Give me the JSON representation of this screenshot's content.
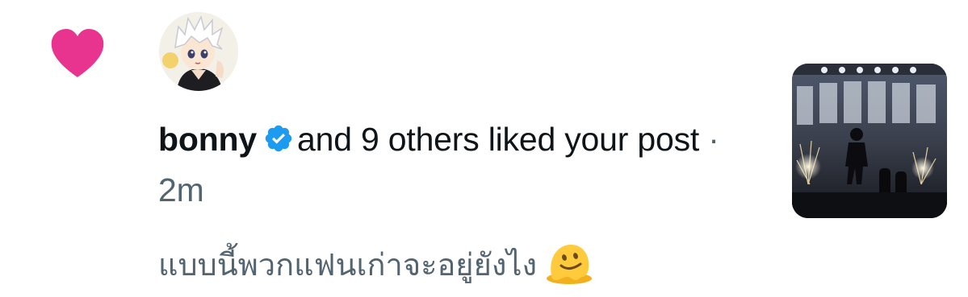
{
  "notification": {
    "icon": "heart-icon",
    "accent_color": "#e8338f",
    "avatar_alt": "anime-avatar",
    "username": "bonny",
    "verified": true,
    "verified_color": "#1d9bf0",
    "action_text": "and 9 others liked your post",
    "separator": "·",
    "time": "2m",
    "comment": "แบบนี้พวกแฟนเก่าจะอยู่ยังไง",
    "comment_emoji": "melting-face-emoji",
    "thumbnail": "concert-stage-photo"
  }
}
